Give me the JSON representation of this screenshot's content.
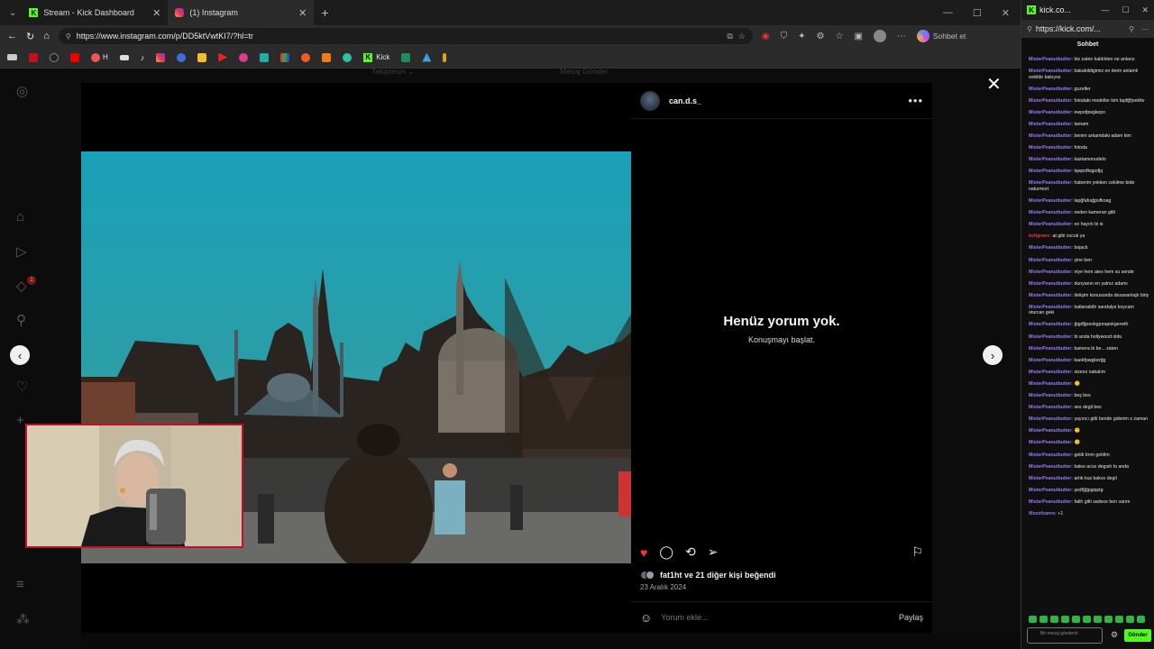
{
  "browser": {
    "tabs": [
      {
        "label": "Stream - Kick Dashboard",
        "close": "✕"
      },
      {
        "label": "(1) Instagram",
        "close": "✕"
      }
    ],
    "new_tab": "+",
    "url": "https://www.instagram.com/p/DD5ktVwtKI7/?hl=tr",
    "sohbet_label": "Sohbet et",
    "bookmark_labels": {
      "h": "H",
      "kick": "Kick"
    }
  },
  "instagram": {
    "ghost_follow": "Takiptesin ⌄",
    "ghost_message": "Mesaj Gönder",
    "notification_count": "1",
    "post": {
      "username": "can.d.s_",
      "empty_title": "Henüz yorum yok.",
      "empty_subtitle": "Konuşmayı başlat.",
      "likes_text": "fat1ht ve 21 diğer kişi beğendi",
      "date": "23 Aralık 2024",
      "comment_placeholder": "Yorum ekle...",
      "share_label": "Paylaş"
    }
  },
  "kick": {
    "tab_title": "kick.co...",
    "url": "https://kick.com/...",
    "chat_title": "Sohbet",
    "messages": [
      {
        "user": "MisterPeanutbutter:",
        "text": "biz zaten kaldıkten ne anlarız"
      },
      {
        "user": "MisterPeanutbutter:",
        "text": "bakabildigimiz en derin anlamlı sekilde bakıyoz"
      },
      {
        "user": "MisterPeanutbutter:",
        "text": "guzeller"
      },
      {
        "user": "MisterPeanutbutter:",
        "text": "fotodaki modeller kim lapfğfjoekfw"
      },
      {
        "user": "MisterPeanutbutter:",
        "text": "ewpofpwgkepo"
      },
      {
        "user": "MisterPeanutbutter:",
        "text": "tamam"
      },
      {
        "user": "MisterPeanutbutter:",
        "text": "benim arkamdaki adam kim"
      },
      {
        "user": "MisterPeanutbutter:",
        "text": "fotoda"
      },
      {
        "user": "MisterPeanutbutter:",
        "text": "kastamonudelo"
      },
      {
        "user": "MisterPeanutbutter:",
        "text": "lqwpofkqpofjq"
      },
      {
        "user": "MisterPeanutbutter:",
        "text": "haberim yokken cekilme bide naturmort"
      },
      {
        "user": "MisterPeanutbutter:",
        "text": "lapğfafıağpsfkoag"
      },
      {
        "user": "MisterPeanutbutter:",
        "text": "neden kameran gitti"
      },
      {
        "user": "MisterPeanutbutter:",
        "text": "oo hayırlı bi is"
      },
      {
        "user": "bellgnaro:",
        "text": "at gibi cocuk ya",
        "red": true
      },
      {
        "user": "MisterPeanutbutter:",
        "text": "bojack"
      },
      {
        "user": "MisterPeanutbutter:",
        "text": "yine ben"
      },
      {
        "user": "MisterPeanutbutter:",
        "text": "niye hem ates hem su sende"
      },
      {
        "user": "MisterPeanutbutter:",
        "text": "dunyanın en yalnız adamı"
      },
      {
        "user": "MisterPeanutbutter:",
        "text": "iletişim konusunda dezavantajlı biriy"
      },
      {
        "user": "MisterPeanutbutter:",
        "text": "katlanabilir sandalye koycam oturcan geki"
      },
      {
        "user": "MisterPeanutbutter:",
        "text": "ğqpfğpeokgpırapokgerwth"
      },
      {
        "user": "MisterPeanutbutter:",
        "text": "bi anda hollywood oldu"
      },
      {
        "user": "MisterPeanutbutter:",
        "text": "kamera bi be... zaten"
      },
      {
        "user": "MisterPeanutbutter:",
        "text": "kaekfpwgkerğg"
      },
      {
        "user": "MisterPeanutbutter:",
        "text": "sizenz nabalım"
      },
      {
        "user": "MisterPeanutbutter:",
        "text": "🙂"
      },
      {
        "user": "MisterPeanutbutter:",
        "text": "beş bes"
      },
      {
        "user": "MisterPeanutbutter:",
        "text": "ses degil bes"
      },
      {
        "user": "MisterPeanutbutter:",
        "text": "yayıncı gitti bende giderim o zaman"
      },
      {
        "user": "MisterPeanutbutter:",
        "text": "🙂"
      },
      {
        "user": "MisterPeanutbutter:",
        "text": "🙂"
      },
      {
        "user": "MisterPeanutbutter:",
        "text": "geldi tmm geldim"
      },
      {
        "user": "MisterPeanutbutter:",
        "text": "bakıs acısı degısh bı anda"
      },
      {
        "user": "MisterPeanutbutter:",
        "text": "artık kus bakısı degil"
      },
      {
        "user": "MisterPeanutbutter:",
        "text": "şsdfğğpgiqstg"
      },
      {
        "user": "MisterPeanutbutter:",
        "text": "fatih gitti sadece ben varım"
      },
      {
        "user": "filozofcanrs:",
        "text": "+1"
      }
    ],
    "input_placeholder": "Bir mesaj gönderin",
    "send_label": "Gönder"
  },
  "colors": {
    "kick_green": "#53fc18",
    "like_red": "#ff3040",
    "chat_user": "#9b7cf7",
    "webcam_border": "#c0102a"
  }
}
